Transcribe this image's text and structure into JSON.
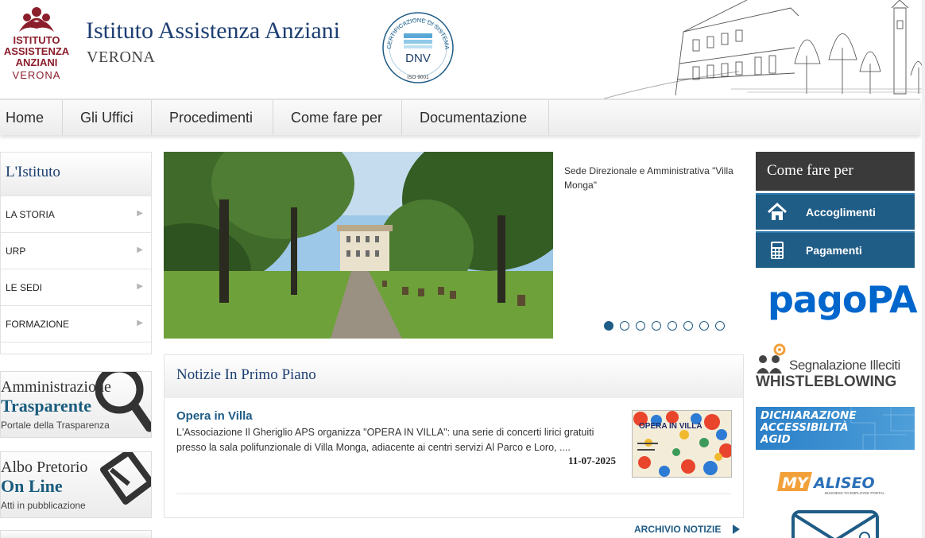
{
  "header": {
    "logo": {
      "line1": "ISTITUTO",
      "line2": "ASSISTENZA",
      "line3": "ANZIANI",
      "line4": "VERONA"
    },
    "title": "Istituto Assistenza Anziani",
    "subtitle": "VERONA",
    "certification": {
      "ring_text": "CERTIFICAZIONE DI SISTEMA QUALITÀ",
      "brand": "DNV",
      "standard": "ISO 9001"
    }
  },
  "nav": {
    "items": [
      {
        "label": "Home"
      },
      {
        "label": "Gli Uffici"
      },
      {
        "label": "Procedimenti"
      },
      {
        "label": "Come fare per"
      },
      {
        "label": "Documentazione"
      }
    ]
  },
  "sidebar": {
    "title": "L'Istituto",
    "items": [
      {
        "label": "LA STORIA"
      },
      {
        "label": "URP"
      },
      {
        "label": "LE SEDI"
      },
      {
        "label": "FORMAZIONE"
      }
    ],
    "banners": [
      {
        "line1": "Amministrazione",
        "line2": "Trasparente",
        "line3": "Portale della Trasparenza"
      },
      {
        "line1": "Albo Pretorio",
        "line2": "On Line",
        "line3": "Atti in pubblicazione"
      }
    ]
  },
  "slider": {
    "caption": "Sede Direzionale e Amministrativa \"Villa Monga\"",
    "slide_count": 8,
    "active_index": 0
  },
  "news": {
    "heading": "Notizie In Primo Piano",
    "items": [
      {
        "title": "Opera in Villa",
        "text": "L'Associazione Il Gheriglio APS organizza \"OPERA IN VILLA\": una serie di concerti lirici gratuiti presso la sala polifunzionale di Villa Monga, adiacente ai centri servizi Al Parco e Loro, ....",
        "date": "11-07-2025",
        "image_caption": "OPERA IN VILLA"
      }
    ],
    "archive_label": "ARCHIVIO NOTIZIE"
  },
  "right": {
    "heading": "Come fare per",
    "buttons": [
      {
        "label": "Accoglimenti",
        "icon": "home-icon"
      },
      {
        "label": "Pagamenti",
        "icon": "calculator-icon"
      }
    ],
    "pagopa": "pagoPA",
    "whistleblowing": {
      "line1": "Segnalazione Illeciti",
      "line2": "WHISTLEBLOWING"
    },
    "agid": {
      "line1": "DICHIARAZIONE",
      "line2": "ACCESSIBILITÀ",
      "line3": "AGID"
    },
    "myaliseo": {
      "my": "MY",
      "name": "ALISEO",
      "tagline": "BUSINESS TO EMPLOYEE PORTAL"
    }
  },
  "colors": {
    "brand_red": "#8b1e2b",
    "title_blue": "#1d3f72",
    "accent_blue": "#1f5c86",
    "dark_header": "#3a3a3a"
  }
}
